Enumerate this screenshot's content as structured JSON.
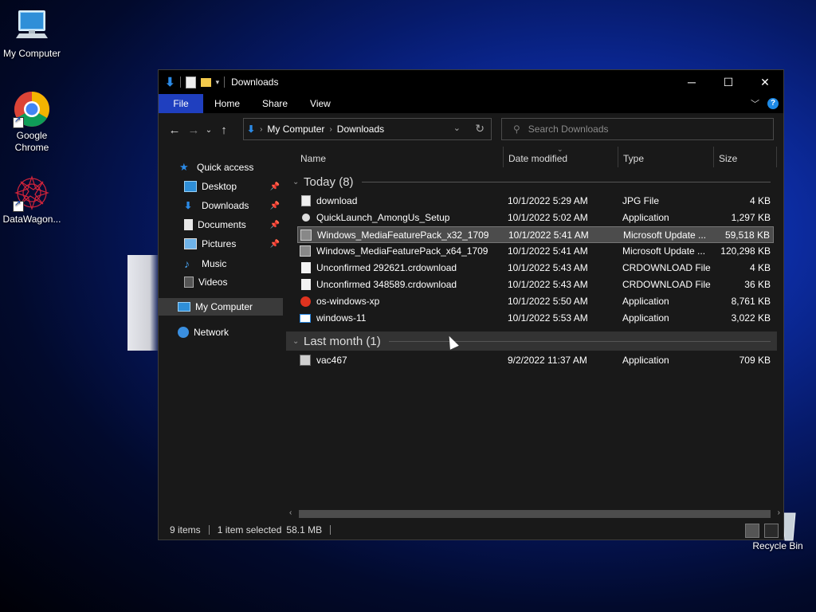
{
  "desktop": {
    "icons": [
      {
        "label": "My Computer"
      },
      {
        "label": "Google Chrome"
      },
      {
        "label": "DataWagon..."
      },
      {
        "label": "Recycle Bin"
      }
    ]
  },
  "window": {
    "title": "Downloads",
    "ribbon_tabs": [
      "File",
      "Home",
      "Share",
      "View"
    ],
    "address": {
      "crumbs": [
        "My Computer",
        "Downloads"
      ]
    },
    "search_placeholder": "Search Downloads",
    "nav": {
      "items": [
        {
          "label": "Quick access"
        },
        {
          "label": "Desktop"
        },
        {
          "label": "Downloads"
        },
        {
          "label": "Documents"
        },
        {
          "label": "Pictures"
        },
        {
          "label": "Music"
        },
        {
          "label": "Videos"
        },
        {
          "label": "My Computer"
        },
        {
          "label": "Network"
        }
      ]
    },
    "columns": [
      "Name",
      "Date modified",
      "Type",
      "Size"
    ],
    "groups": [
      {
        "label": "Today (8)"
      },
      {
        "label": "Last month (1)"
      }
    ],
    "files": [
      {
        "name": "download",
        "date": "10/1/2022 5:29 AM",
        "type": "JPG File",
        "size": "4 KB"
      },
      {
        "name": "QuickLaunch_AmongUs_Setup",
        "date": "10/1/2022 5:02 AM",
        "type": "Application",
        "size": "1,297 KB"
      },
      {
        "name": "Windows_MediaFeaturePack_x32_1709",
        "date": "10/1/2022 5:41 AM",
        "type": "Microsoft Update ...",
        "size": "59,518 KB"
      },
      {
        "name": "Windows_MediaFeaturePack_x64_1709",
        "date": "10/1/2022 5:41 AM",
        "type": "Microsoft Update ...",
        "size": "120,298 KB"
      },
      {
        "name": "Unconfirmed 292621.crdownload",
        "date": "10/1/2022 5:43 AM",
        "type": "CRDOWNLOAD File",
        "size": "4 KB"
      },
      {
        "name": "Unconfirmed 348589.crdownload",
        "date": "10/1/2022 5:43 AM",
        "type": "CRDOWNLOAD File",
        "size": "36 KB"
      },
      {
        "name": "os-windows-xp",
        "date": "10/1/2022 5:50 AM",
        "type": "Application",
        "size": "8,761 KB"
      },
      {
        "name": "windows-11",
        "date": "10/1/2022 5:53 AM",
        "type": "Application",
        "size": "3,022 KB"
      },
      {
        "name": "vac467",
        "date": "9/2/2022 11:37 AM",
        "type": "Application",
        "size": "709 KB"
      }
    ],
    "status": {
      "items": "9 items",
      "selected": "1 item selected",
      "size": "58.1 MB"
    }
  },
  "colors": {
    "file_tab": "#1f3fbf",
    "accent": "#1e8ae6"
  }
}
